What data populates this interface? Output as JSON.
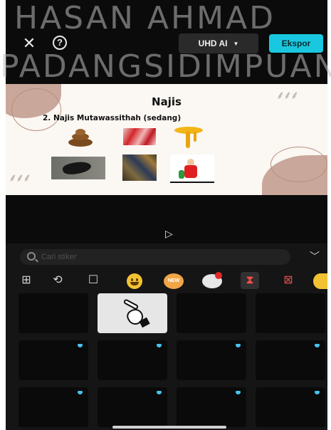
{
  "watermark": {
    "line1": "HASAN AHMAD",
    "line2": "PADANGSIDIMPUAN"
  },
  "toolbar": {
    "close_glyph": "✕",
    "help_glyph": "?",
    "quality_label": "UHD AI",
    "quality_caret": "▼",
    "export_label": "Ekspor"
  },
  "slide": {
    "title": "Najis",
    "subtitle": "2. Najis Mutawassithah (sedang)"
  },
  "player": {
    "play_glyph": "▷"
  },
  "sticker_panel": {
    "search": {
      "placeholder": "Cari stiker"
    },
    "collapse_glyph": "﹀",
    "categories": [
      {
        "name": "add-sticker",
        "glyph": "⊞"
      },
      {
        "name": "ai-sticker",
        "glyph": "⟲"
      },
      {
        "name": "bookmark",
        "glyph": "☐"
      },
      {
        "name": "emoji",
        "glyph": ""
      },
      {
        "name": "new",
        "glyph": "NEW"
      },
      {
        "name": "chat",
        "glyph": ""
      },
      {
        "name": "trending",
        "glyph": "⧗"
      },
      {
        "name": "red-box",
        "glyph": "⊠"
      },
      {
        "name": "face",
        "glyph": ""
      }
    ],
    "selected_index": 1,
    "premium_badge_color": "#46c4ee"
  },
  "colors": {
    "export_accent": "#19c8e0",
    "panel_bg": "#151515",
    "slide_bg": "#fbf7f3"
  }
}
